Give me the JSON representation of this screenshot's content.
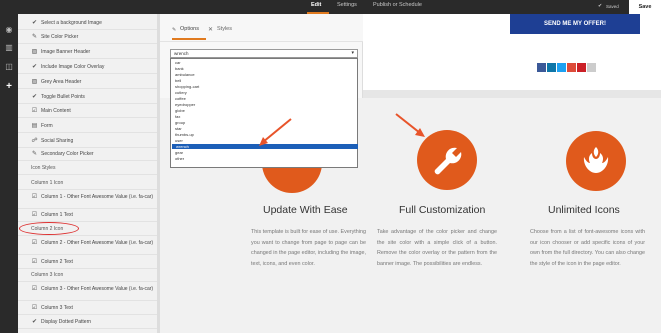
{
  "topbar": {
    "tabs": [
      "Edit",
      "Settings",
      "Publish or Schedule"
    ],
    "saved_label": "Saved",
    "save_button": "Save"
  },
  "sidebar": {
    "items": [
      {
        "icon": "check-icon",
        "label": "Select a background Image"
      },
      {
        "icon": "pencil-icon",
        "label": "Site Color Picker"
      },
      {
        "icon": "image-icon",
        "label": "Image Banner Header"
      },
      {
        "icon": "check-icon",
        "label": "Include Image Color Overlay"
      },
      {
        "icon": "image-icon",
        "label": "Grey Area Header"
      },
      {
        "icon": "check-icon",
        "label": "Toggle Bullet Points"
      },
      {
        "icon": "edit-icon",
        "label": "Main Content"
      },
      {
        "icon": "form-icon",
        "label": "Form"
      },
      {
        "icon": "share-icon",
        "label": "Social Sharing"
      },
      {
        "icon": "pencil-icon",
        "label": "Secondary Color Picker"
      },
      {
        "icon": "",
        "label": "Icon Styles"
      },
      {
        "icon": "",
        "label": "Column 1 Icon"
      },
      {
        "icon": "edit-icon",
        "label": "Column 1 - Other Font Awesome Value (i.e. fa-car)"
      },
      {
        "icon": "edit-icon",
        "label": "Column 1 Text"
      },
      {
        "icon": "",
        "label": "Column 2 Icon"
      },
      {
        "icon": "edit-icon",
        "label": "Column 2 - Other Font Awesome Value (i.e. fa-car)"
      },
      {
        "icon": "edit-icon",
        "label": "Column 2 Text"
      },
      {
        "icon": "",
        "label": "Column 3 Icon"
      },
      {
        "icon": "edit-icon",
        "label": "Column 3 - Other Font Awesome Value (i.e. fa-car)"
      },
      {
        "icon": "edit-icon",
        "label": "Column 3 Text"
      },
      {
        "icon": "check-icon",
        "label": "Display Dotted Pattern"
      }
    ]
  },
  "panel": {
    "tabs": [
      "Options",
      "Styles"
    ],
    "select_value": "wrench",
    "options": [
      "car",
      "bank",
      "ambulance",
      "bell",
      "shopping-cart",
      "cutlery",
      "coffee",
      "eyedropper",
      "globe",
      "fax",
      "group",
      "star",
      "thumbs-up",
      "user",
      "wrench",
      "gear",
      "other"
    ],
    "selected_option": "wrench"
  },
  "preview": {
    "offer_button": "SEND ME MY OFFER!",
    "features": [
      {
        "title": "Update With Ease",
        "text": "This template is built for ease of use. Everything you want to change from page to page can be changed in the page editor, including the image, text, icons, and even color."
      },
      {
        "title": "Full Customization",
        "text": "Take advantage of the color picker and change the site color with a simple click of a button. Remove the color overlay or the pattern from the banner image. The possibilities are endless."
      },
      {
        "title": "Unlimited Icons",
        "text": "Choose from a list of font-awesome icons with our icon chooser or add specific icons of your own from the full directory. You can also change the style of the icon in the page editor."
      }
    ]
  },
  "colors": {
    "accent": "#e07a1f",
    "icon_circle": "#e05a1c",
    "offer_button": "#1e3f94",
    "topbar": "#2a2a2a",
    "annotation": "#e8542a"
  }
}
